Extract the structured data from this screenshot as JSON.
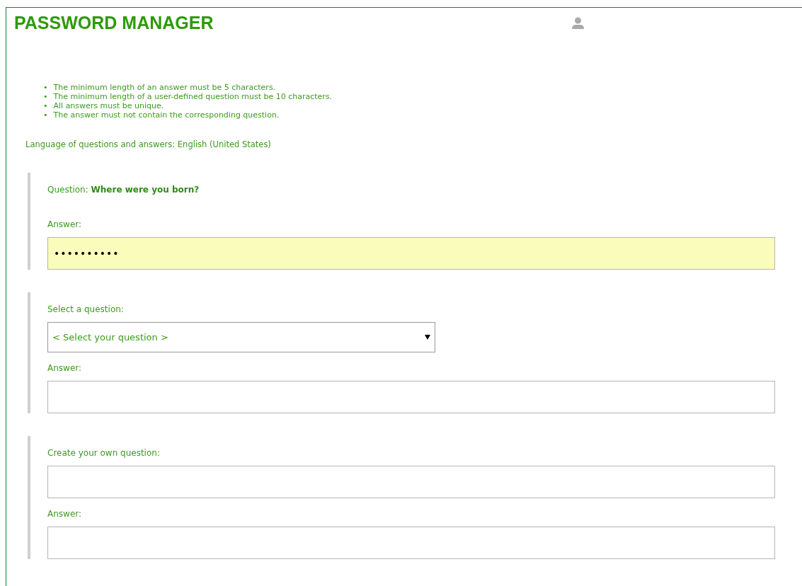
{
  "header": {
    "title": "PASSWORD MANAGER"
  },
  "rules": [
    {
      "marker": "•",
      "text": "The minimum length of an answer must be 5 characters."
    },
    {
      "marker": "•",
      "text": "The minimum length of a user-defined question must be 10 characters."
    },
    {
      "marker": "•",
      "text": "All answers must be unique."
    },
    {
      "marker": "•",
      "text": "The answer must not contain the corresponding question."
    }
  ],
  "language": "Language of questions and answers: English (United States)",
  "sections": [
    {
      "items": [
        {
          "kind": "question",
          "label": "Question:",
          "text": "Where were you born?"
        },
        {
          "kind": "label",
          "text": "Answer:"
        },
        {
          "kind": "field",
          "value": "••••••••••",
          "highlighted": true
        }
      ]
    },
    {
      "items": [
        {
          "kind": "label",
          "text": "Select a question:"
        },
        {
          "kind": "select",
          "value": "< Select your question >"
        },
        {
          "kind": "label",
          "text": "Answer:"
        },
        {
          "kind": "field",
          "highlighted": false
        }
      ]
    },
    {
      "items": [
        {
          "kind": "label",
          "text": "Create your own question:"
        },
        {
          "kind": "field",
          "highlighted": false
        },
        {
          "kind": "label",
          "text": "Answer:"
        },
        {
          "kind": "field",
          "highlighted": false
        }
      ]
    }
  ]
}
